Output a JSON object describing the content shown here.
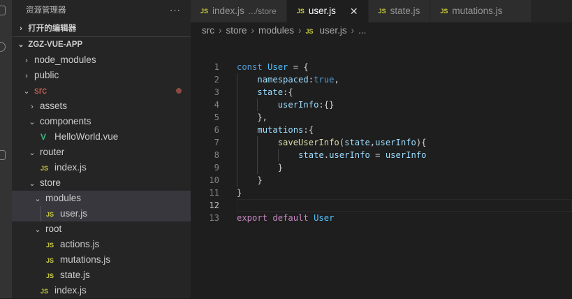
{
  "sidebar": {
    "title": "资源管理器",
    "more": "···",
    "open_editors": "打开的编辑器",
    "project": "ZGZ-VUE-APP",
    "tree": [
      {
        "label": "node_modules",
        "kind": "folder",
        "open": false,
        "depth": 1
      },
      {
        "label": "public",
        "kind": "folder",
        "open": false,
        "depth": 1
      },
      {
        "label": "src",
        "kind": "folder",
        "open": true,
        "depth": 1,
        "modified": true
      },
      {
        "label": "assets",
        "kind": "folder",
        "open": false,
        "depth": 2
      },
      {
        "label": "components",
        "kind": "folder",
        "open": true,
        "depth": 2
      },
      {
        "label": "HelloWorld.vue",
        "kind": "vue",
        "depth": 3
      },
      {
        "label": "router",
        "kind": "folder",
        "open": true,
        "depth": 2
      },
      {
        "label": "index.js",
        "kind": "js",
        "depth": 3
      },
      {
        "label": "store",
        "kind": "folder",
        "open": true,
        "depth": 2
      },
      {
        "label": "modules",
        "kind": "folder",
        "open": true,
        "depth": 3,
        "selected": true
      },
      {
        "label": "user.js",
        "kind": "js",
        "depth": 4,
        "selected": true
      },
      {
        "label": "root",
        "kind": "folder",
        "open": true,
        "depth": 3
      },
      {
        "label": "actions.js",
        "kind": "js",
        "depth": 4
      },
      {
        "label": "mutations.js",
        "kind": "js",
        "depth": 4
      },
      {
        "label": "state.js",
        "kind": "js",
        "depth": 4
      },
      {
        "label": "index.js",
        "kind": "js",
        "depth": 3
      }
    ]
  },
  "icons": {
    "js": "JS",
    "vue": "V",
    "chevron_right": "›",
    "chevron_down": "⌄",
    "close": "✕"
  },
  "tabs": [
    {
      "label": "index.js",
      "desc": ".../store",
      "active": false
    },
    {
      "label": "user.js",
      "active": true
    },
    {
      "label": "state.js",
      "active": false
    },
    {
      "label": "mutations.js",
      "active": false
    }
  ],
  "breadcrumb": [
    "src",
    "store",
    "modules",
    "user.js",
    "..."
  ],
  "code": {
    "current_line": 12,
    "lines": [
      [
        [
          "kw",
          "const "
        ],
        [
          "cls",
          "User"
        ],
        [
          "pl",
          " = {"
        ]
      ],
      [
        [
          "pl",
          "    "
        ],
        [
          "prop",
          "namespaced"
        ],
        [
          "pl",
          ":"
        ],
        [
          "kw",
          "true"
        ],
        [
          "pl",
          ","
        ]
      ],
      [
        [
          "pl",
          "    "
        ],
        [
          "prop",
          "state"
        ],
        [
          "pl",
          ":{"
        ]
      ],
      [
        [
          "pl",
          "        "
        ],
        [
          "prop",
          "userInfo"
        ],
        [
          "pl",
          ":{}"
        ]
      ],
      [
        [
          "pl",
          "    },"
        ]
      ],
      [
        [
          "pl",
          "    "
        ],
        [
          "prop",
          "mutations"
        ],
        [
          "pl",
          ":{"
        ]
      ],
      [
        [
          "pl",
          "        "
        ],
        [
          "fn",
          "saveUserInfo"
        ],
        [
          "pl",
          "("
        ],
        [
          "prop",
          "state"
        ],
        [
          "pl",
          ","
        ],
        [
          "prop",
          "userInfo"
        ],
        [
          "pl",
          "){"
        ]
      ],
      [
        [
          "pl",
          "            "
        ],
        [
          "prop",
          "state"
        ],
        [
          "pl",
          "."
        ],
        [
          "prop",
          "userInfo"
        ],
        [
          "pl",
          " = "
        ],
        [
          "prop",
          "userInfo"
        ]
      ],
      [
        [
          "pl",
          "        }"
        ]
      ],
      [
        [
          "pl",
          "    }"
        ]
      ],
      [
        [
          "pl",
          "}"
        ]
      ],
      [],
      [
        [
          "ctl",
          "export default "
        ],
        [
          "cls",
          "User"
        ]
      ]
    ],
    "guides": [
      [],
      [
        1
      ],
      [
        1
      ],
      [
        1,
        2
      ],
      [
        1
      ],
      [
        1
      ],
      [
        1,
        2
      ],
      [
        1,
        2,
        3
      ],
      [
        1,
        2
      ],
      [
        1
      ],
      [],
      [],
      []
    ]
  }
}
